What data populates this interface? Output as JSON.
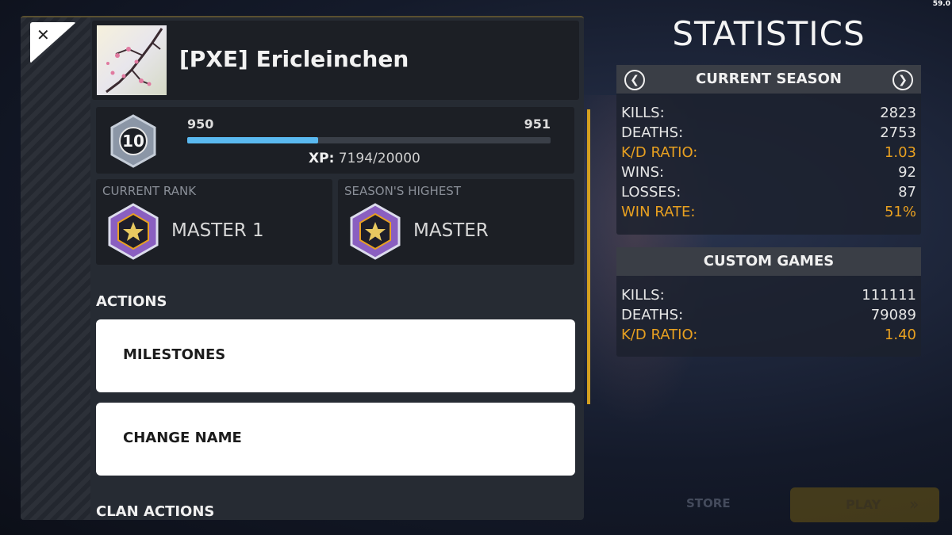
{
  "fps": "59.0",
  "profile": {
    "name": "[PXE] Ericleinchen",
    "level": "10",
    "level_from": "950",
    "level_to": "951",
    "xp_label": "XP:",
    "xp_value": "7194/20000",
    "xp_progress": 0.36
  },
  "ranks": {
    "current": {
      "title": "CURRENT RANK",
      "name": "MASTER 1"
    },
    "highest": {
      "title": "SEASON'S HIGHEST",
      "name": "MASTER"
    }
  },
  "actions": {
    "title": "ACTIONS",
    "buttons": [
      "MILESTONES",
      "CHANGE NAME"
    ],
    "clan_title": "CLAN ACTIONS"
  },
  "statistics": {
    "title": "STATISTICS",
    "current_season": {
      "header": "CURRENT SEASON",
      "rows": [
        {
          "label": "KILLS:",
          "value": "2823",
          "highlight": false
        },
        {
          "label": "DEATHS:",
          "value": "2753",
          "highlight": false
        },
        {
          "label": "K/D RATIO:",
          "value": "1.03",
          "highlight": true
        },
        {
          "label": "WINS:",
          "value": "92",
          "highlight": false
        },
        {
          "label": "LOSSES:",
          "value": "87",
          "highlight": false
        },
        {
          "label": "WIN RATE:",
          "value": "51%",
          "highlight": true
        }
      ]
    },
    "custom_games": {
      "header": "CUSTOM GAMES",
      "rows": [
        {
          "label": "KILLS:",
          "value": "111111",
          "highlight": false
        },
        {
          "label": "DEATHS:",
          "value": "79089",
          "highlight": false
        },
        {
          "label": "K/D RATIO:",
          "value": "1.40",
          "highlight": true
        }
      ]
    }
  },
  "bottom_nav": {
    "store": "STORE",
    "play": "PLAY"
  },
  "colors": {
    "accent": "#e8a020",
    "xp_bar": "#5ab9f0",
    "rank_purple": "#8a5fc0"
  }
}
